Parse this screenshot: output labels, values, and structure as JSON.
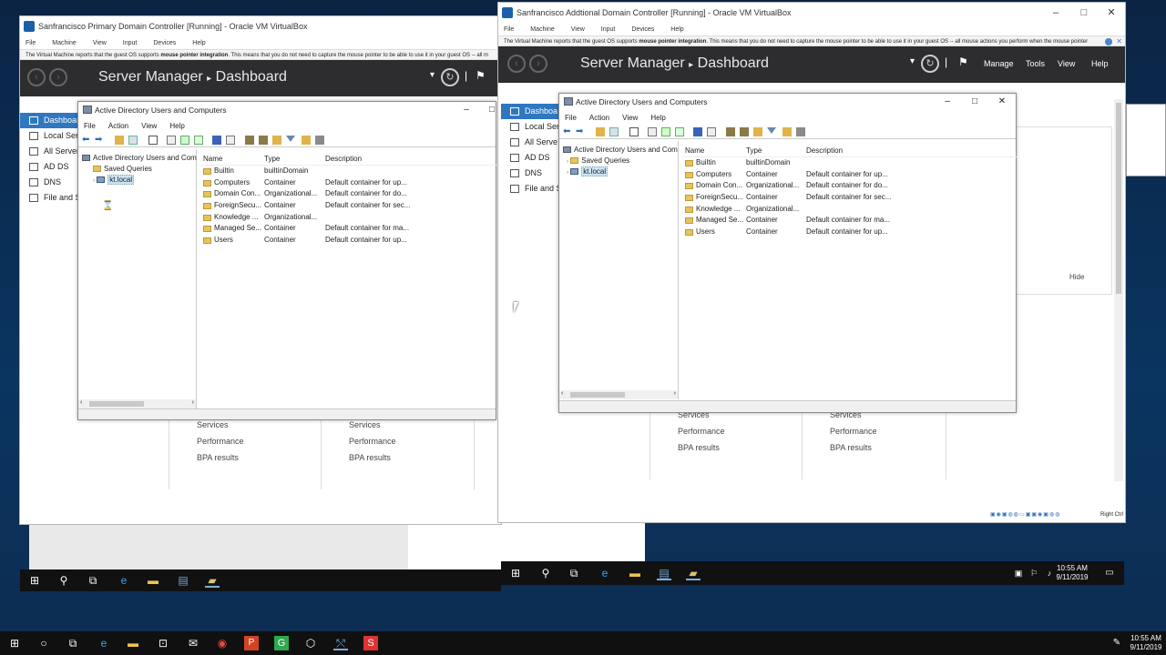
{
  "left_vm": {
    "title": "Sanfrancisco Primary Domain Controller [Running] - Oracle VM VirtualBox",
    "menu": [
      "File",
      "Machine",
      "View",
      "Input",
      "Devices",
      "Help"
    ],
    "notice_pre": "The Virtual Machine reports that the guest OS supports",
    "notice_bold": "mouse pointer integration",
    "notice_post": ". This means that you do not need to capture the mouse pointer to be able to use it in your guest OS -- all m",
    "sm_title": "Server Manager",
    "sm_sep": "▸",
    "sm_page": "Dashboard",
    "sidebar": [
      "Dashboard",
      "Local Ser",
      "All Server",
      "AD DS",
      "DNS",
      "File and S"
    ],
    "tiles": [
      [
        "Services",
        "Performance",
        "BPA results"
      ],
      [
        "Services",
        "Performance",
        "BPA results"
      ]
    ]
  },
  "right_vm": {
    "title": "Sanfrancisco Addtional Domain Controller [Running] - Oracle VM VirtualBox",
    "menu": [
      "File",
      "Machine",
      "View",
      "Input",
      "Devices",
      "Help"
    ],
    "notice_pre": "The Virtual Machine reports that the guest OS supports",
    "notice_bold": "mouse pointer integration",
    "notice_post": ". This means that you do not need to capture the mouse pointer to be able to use it in your guest OS -- all mouse actions you perform when the mouse pointer",
    "sm_title": "Server Manager",
    "sm_sep": "▸",
    "sm_page": "Dashboard",
    "sm_menu": [
      "Manage",
      "Tools",
      "View",
      "Help"
    ],
    "sidebar": [
      "Dashboa",
      "Local Serv",
      "All Serve",
      "AD DS",
      "DNS",
      "File and S"
    ],
    "hide_label": "Hide",
    "tiles": [
      [
        "Services",
        "Performance",
        "BPA results"
      ],
      [
        "Services",
        "Performance",
        "BPA results"
      ]
    ],
    "clock_time": "10:55 AM",
    "clock_date": "9/11/2019",
    "host_key": "Right Ctrl"
  },
  "aduc": {
    "title": "Active Directory Users and Computers",
    "menu": [
      "File",
      "Action",
      "View",
      "Help"
    ],
    "tree_root": "Active Directory Users and Com",
    "tree_items": [
      "Saved Queries",
      "kt.local"
    ],
    "columns": [
      "Name",
      "Type",
      "Description"
    ],
    "rows": [
      {
        "name": "Builtin",
        "type": "builtinDomain",
        "desc": ""
      },
      {
        "name": "Computers",
        "type": "Container",
        "desc": "Default container for up..."
      },
      {
        "name": "Domain Con...",
        "type": "Organizational...",
        "desc": "Default container for do..."
      },
      {
        "name": "ForeignSecu...",
        "type": "Container",
        "desc": "Default container for sec..."
      },
      {
        "name": "Knowledge ...",
        "type": "Organizational...",
        "desc": ""
      },
      {
        "name": "Managed Se...",
        "type": "Container",
        "desc": "Default container for ma..."
      },
      {
        "name": "Users",
        "type": "Container",
        "desc": "Default container for up..."
      }
    ]
  },
  "host": {
    "clock_time": "10:55 AM",
    "clock_date": "9/11/2019"
  },
  "colors": {
    "accent": "#2f78c0",
    "sm_bar": "#2d2d30",
    "taskbar": "#101010"
  }
}
